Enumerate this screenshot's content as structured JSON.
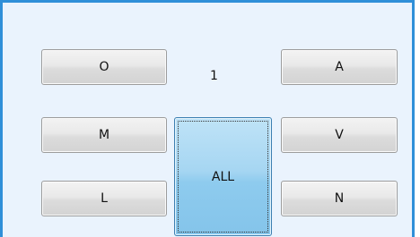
{
  "panel": {
    "counter": "1",
    "buttons": {
      "o": "O",
      "a": "A",
      "m": "M",
      "v": "V",
      "l": "L",
      "n": "N",
      "all": "ALL"
    }
  },
  "colors": {
    "frame_border": "#2f8fd8",
    "panel_background": "#eaf3fd",
    "active_button": "#a6d6f2"
  }
}
